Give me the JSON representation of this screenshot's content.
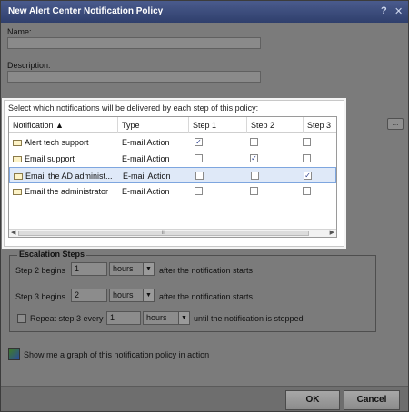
{
  "window": {
    "title": "New Alert Center Notification Policy",
    "help_glyph": "?",
    "close_glyph": "✕"
  },
  "fields": {
    "name_label": "Name:",
    "name_value": "",
    "description_label": "Description:",
    "description_value": ""
  },
  "ellipsis_button": "...",
  "notifications": {
    "caption": "Select which notifications will be delivered by each step of this policy:",
    "columns": [
      "Notification ▲",
      "Type",
      "Step 1",
      "Step 2",
      "Step 3"
    ],
    "rows": [
      {
        "name": "Alert tech support",
        "type": "E-mail Action",
        "steps": [
          true,
          false,
          false
        ],
        "selected": false
      },
      {
        "name": "Email support",
        "type": "E-mail Action",
        "steps": [
          false,
          true,
          false
        ],
        "selected": false
      },
      {
        "name": "Email the AD administ...",
        "type": "E-mail Action",
        "steps": [
          false,
          false,
          true
        ],
        "selected": true
      },
      {
        "name": "Email the administrator",
        "type": "E-mail Action",
        "steps": [
          false,
          false,
          false
        ],
        "selected": false
      }
    ],
    "scroll_thumb_glyph": "III"
  },
  "escalation": {
    "legend": "Escalation Steps",
    "step2_label": "Step 2 begins",
    "step2_value": "1",
    "step2_unit": "hours",
    "step2_suffix": "after the notification starts",
    "step3_label": "Step 3 begins",
    "step3_value": "2",
    "step3_unit": "hours",
    "step3_suffix": "after the notification starts",
    "repeat_label": "Repeat step 3 every",
    "repeat_value": "1",
    "repeat_unit": "hours",
    "repeat_suffix": "until the notification is stopped"
  },
  "graph_option": "Show me a graph of this notification policy in action",
  "buttons": {
    "ok": "OK",
    "cancel": "Cancel"
  },
  "colors": {
    "title_bar": "#3a4a7c",
    "selection": "#dfe9f8",
    "checkmark": "#2b3f8c"
  }
}
